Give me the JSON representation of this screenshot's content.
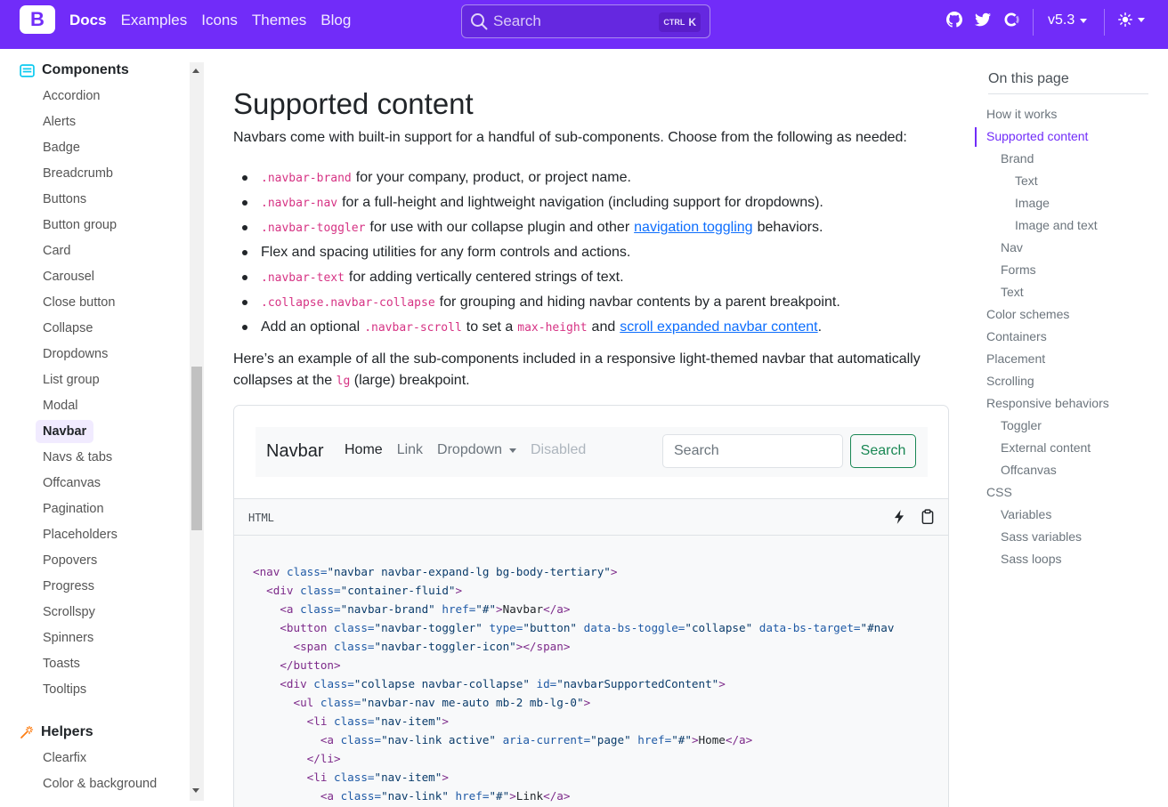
{
  "topnav": {
    "brand_letter": "B",
    "links": [
      "Docs",
      "Examples",
      "Icons",
      "Themes",
      "Blog"
    ],
    "search_placeholder": "Search",
    "kbd_ctrl": "CTRL",
    "kbd_key": "K",
    "version": "v5.3",
    "accent": "#712cf9"
  },
  "sidebar": {
    "group1": "Components",
    "items": [
      "Accordion",
      "Alerts",
      "Badge",
      "Breadcrumb",
      "Buttons",
      "Button group",
      "Card",
      "Carousel",
      "Close button",
      "Collapse",
      "Dropdowns",
      "List group",
      "Modal",
      "Navbar",
      "Navs & tabs",
      "Offcanvas",
      "Pagination",
      "Placeholders",
      "Popovers",
      "Progress",
      "Scrollspy",
      "Spinners",
      "Toasts",
      "Tooltips"
    ],
    "active": "Navbar",
    "group2": "Helpers",
    "items2": [
      "Clearfix",
      "Color & background"
    ]
  },
  "main": {
    "title": "Supported content",
    "lead": "Navbars come with built-in support for a handful of sub-components. Choose from the following as needed:",
    "bullets": [
      {
        "code": ".navbar-brand",
        "text": "for your company, product, or project name."
      },
      {
        "code": ".navbar-nav",
        "text": "for a full-height and lightweight navigation (including support for dropdowns)."
      },
      {
        "code": ".navbar-toggler",
        "text": "for use with our collapse plugin and other",
        "link": "navigation toggling",
        "after": "behaviors."
      },
      {
        "text": "Flex and spacing utilities for any form controls and actions."
      },
      {
        "code": ".navbar-text",
        "text": "for adding vertically centered strings of text."
      },
      {
        "code": ".collapse.navbar-collapse",
        "text": "for grouping and hiding navbar contents by a parent breakpoint."
      },
      {
        "pre": "Add an optional",
        "code": ".navbar-scroll",
        "mid": "to set a",
        "code2": "max-height",
        "and": "and",
        "link": "scroll expanded navbar content",
        "after": "."
      }
    ],
    "para2_a": "Here’s an example of all the sub-components included in a responsive light-themed navbar that automatically collapses at the",
    "para2_code": "lg",
    "para2_b": "(large) breakpoint."
  },
  "demo": {
    "brand": "Navbar",
    "links": [
      "Home",
      "Link",
      "Dropdown",
      "Disabled"
    ],
    "search_placeholder": "Search",
    "search_button": "Search",
    "code_lang": "HTML"
  },
  "toc": {
    "title": "On this page",
    "items": [
      {
        "label": "How it works",
        "level": 0
      },
      {
        "label": "Supported content",
        "level": 0,
        "active": true
      },
      {
        "label": "Brand",
        "level": 1
      },
      {
        "label": "Text",
        "level": 2
      },
      {
        "label": "Image",
        "level": 2
      },
      {
        "label": "Image and text",
        "level": 2
      },
      {
        "label": "Nav",
        "level": 1
      },
      {
        "label": "Forms",
        "level": 1
      },
      {
        "label": "Text",
        "level": 1
      },
      {
        "label": "Color schemes",
        "level": 0
      },
      {
        "label": "Containers",
        "level": 0
      },
      {
        "label": "Placement",
        "level": 0
      },
      {
        "label": "Scrolling",
        "level": 0
      },
      {
        "label": "Responsive behaviors",
        "level": 0
      },
      {
        "label": "Toggler",
        "level": 1
      },
      {
        "label": "External content",
        "level": 1
      },
      {
        "label": "Offcanvas",
        "level": 1
      },
      {
        "label": "CSS",
        "level": 0
      },
      {
        "label": "Variables",
        "level": 1
      },
      {
        "label": "Sass variables",
        "level": 1
      },
      {
        "label": "Sass loops",
        "level": 1
      }
    ]
  }
}
